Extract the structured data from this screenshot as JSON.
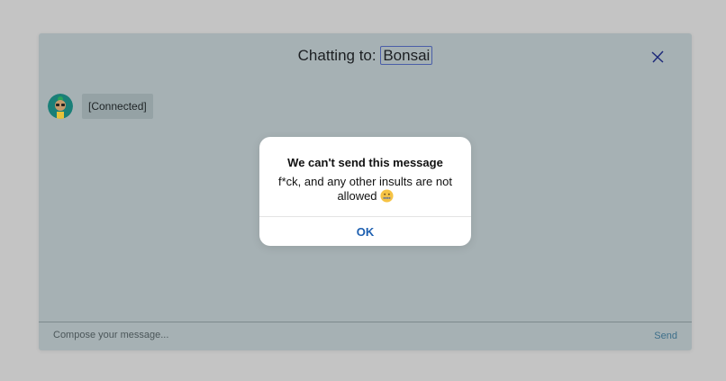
{
  "chat": {
    "title_prefix": "Chatting to:",
    "contact_name": "Bonsai",
    "status_message": "[Connected]",
    "compose_placeholder": "Compose your message...",
    "send_label": "Send"
  },
  "modal": {
    "title": "We can't send this message",
    "body": "f*ck, and any other insults are not allowed",
    "emoji_icon": "zipper-mouth-face",
    "ok_label": "OK"
  },
  "colors": {
    "overlay": "#c4c4c4",
    "window_bg": "#a6b1b4",
    "bubble_bg": "#95a2a5",
    "ok_blue": "#1d5fb0",
    "send_color": "#3d6f8a"
  }
}
